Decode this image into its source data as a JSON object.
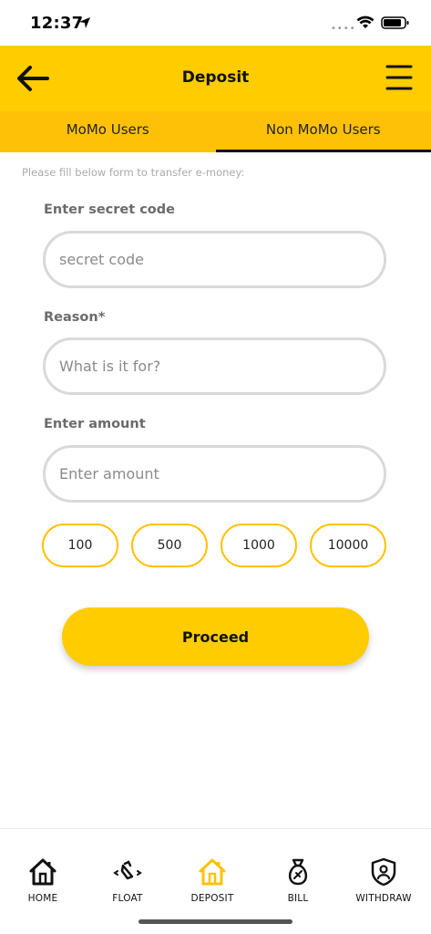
{
  "status_bar": {
    "time": "12:37",
    "signal_dots": "••••"
  },
  "header": {
    "title": "Deposit",
    "back_icon": "back-arrow-icon",
    "menu_icon": "hamburger-menu-icon",
    "color": "#FFCC00"
  },
  "tabs": [
    {
      "label": "MoMo Users",
      "active": false
    },
    {
      "label": "Non MoMo Users",
      "active": true
    }
  ],
  "form": {
    "intro": "Please fill below form to transfer e-money:",
    "secret_code": {
      "label": "Enter secret code",
      "placeholder": "secret code",
      "value": ""
    },
    "reason": {
      "label": "Reason*",
      "placeholder": "What is it for?",
      "value": ""
    },
    "amount": {
      "label": "Enter amount",
      "placeholder": "Enter amount",
      "value": ""
    },
    "quick_amounts": [
      "100",
      "500",
      "1000",
      "10000"
    ],
    "proceed_label": "Proceed"
  },
  "bottom_nav": [
    {
      "label": "HOME",
      "icon": "home-icon",
      "active": false
    },
    {
      "label": "FLOAT",
      "icon": "float-icon",
      "active": false
    },
    {
      "label": "DEPOSIT",
      "icon": "deposit-home-icon",
      "active": true
    },
    {
      "label": "BILL",
      "icon": "money-bag-icon",
      "active": false
    },
    {
      "label": "WITHDRAW",
      "icon": "shield-user-icon",
      "active": false
    }
  ],
  "colors": {
    "accent": "#FFCC00",
    "tab_bg": "#FFC107",
    "chip_border": "#FFC107"
  }
}
